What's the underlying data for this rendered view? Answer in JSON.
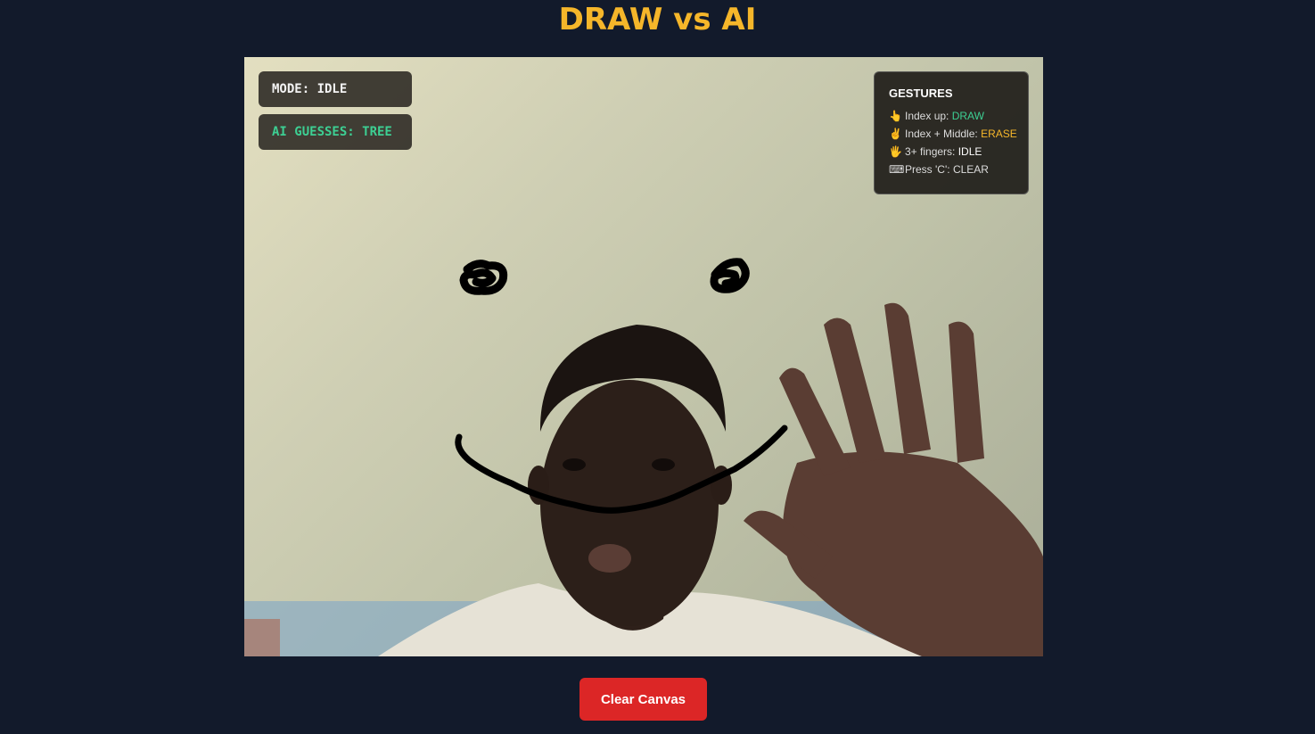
{
  "app": {
    "title": "DRAW vs AI"
  },
  "status": {
    "mode": "MODE: IDLE",
    "guess": "AI GUESSES: TREE"
  },
  "gestures": {
    "title": "GESTURES",
    "items": [
      {
        "icon": "👆",
        "icon_name": "pointing-up-icon",
        "label": "Index up: ",
        "value": "DRAW",
        "value_color": "#3dcf93"
      },
      {
        "icon": "✌",
        "icon_name": "victory-hand-icon",
        "label": "Index + Middle: ",
        "value": "ERASE",
        "value_color": "#f5b62a"
      },
      {
        "icon": "🖐",
        "icon_name": "open-hand-icon",
        "label": "3+ fingers: ",
        "value": "IDLE",
        "value_color": "#ffffff"
      },
      {
        "icon": "⌨",
        "icon_name": "keyboard-icon",
        "label": "Press 'C': ",
        "value": "CLEAR",
        "value_color": "#dcdcdc"
      }
    ]
  },
  "controls": {
    "clear_label": "Clear Canvas"
  },
  "colors": {
    "background": "#121a2b",
    "title": "#f5b62a",
    "accent_green": "#3dcf93",
    "accent_orange": "#f5b62a",
    "clear_button": "#dc2626"
  }
}
